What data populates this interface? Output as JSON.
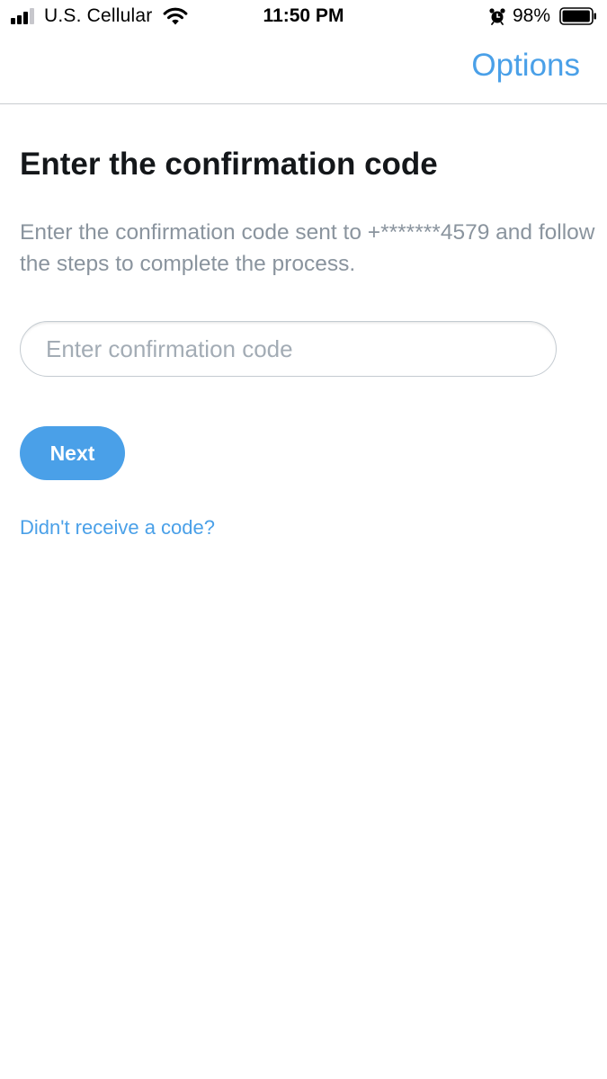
{
  "status_bar": {
    "carrier": "U.S. Cellular",
    "time": "11:50 PM",
    "battery_percent": "98%",
    "battery_level": 0.98,
    "icons": [
      "signal-icon",
      "wifi-icon",
      "alarm-icon",
      "battery-icon"
    ]
  },
  "header": {
    "options_label": "Options"
  },
  "main": {
    "title": "Enter the confirmation code",
    "description": "Enter the confirmation code sent to +*******4579 and follow the steps to complete the process.",
    "code_input": {
      "value": "",
      "placeholder": "Enter confirmation code"
    },
    "next_label": "Next",
    "resend_link": "Didn't receive a code?"
  },
  "colors": {
    "accent": "#4aa0e8",
    "title_text": "#14171a",
    "secondary_text": "#8a949e",
    "placeholder_text": "#a3acb5",
    "divider": "#c9ccd0"
  }
}
